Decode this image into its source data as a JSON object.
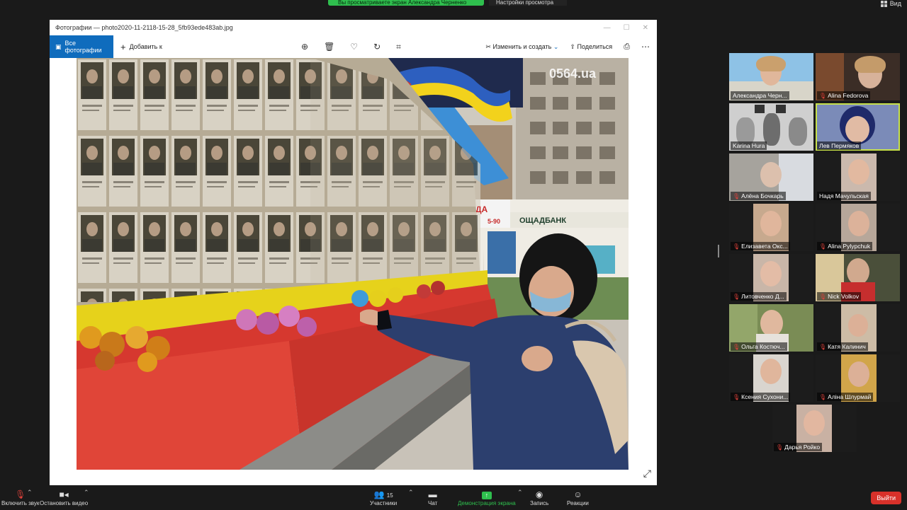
{
  "top": {
    "share_banner": "Вы просматриваете экран Александра Черненко",
    "view_settings": "Настройки просмотра",
    "view_label": "Вид"
  },
  "photo_window": {
    "title": "Фотографии — photo2020-11-2118-15-28_5fb93ede483ab.jpg",
    "all_photos": "Все фотографии",
    "add": "Добавить к",
    "edit_create": "Изменить и создать",
    "share": "Поделиться",
    "watermark": "0564.ua",
    "shop_sign": "ОЩАДБАНК",
    "sign_partial": "ДА",
    "sign_partial2": "5-90"
  },
  "participants": [
    {
      "name": "Александра Черн...",
      "muted": false
    },
    {
      "name": "Alina Fedorova",
      "muted": true
    },
    {
      "name": "Karina Hura",
      "muted": false
    },
    {
      "name": "Лев Пермяков",
      "muted": false,
      "active": true
    },
    {
      "name": "Алёна Бочкарь",
      "muted": true
    },
    {
      "name": "Надя Мачульская",
      "muted": false
    },
    {
      "name": "Елизавета Окс...",
      "muted": true
    },
    {
      "name": "Alina Pylypchuk",
      "muted": true
    },
    {
      "name": "Литовченко Д...",
      "muted": true
    },
    {
      "name": "Nick Volkov",
      "muted": true
    },
    {
      "name": "Ольга Костюч...",
      "muted": true
    },
    {
      "name": "Катя Калинич",
      "muted": true
    },
    {
      "name": "Ксения Сухони...",
      "muted": true
    },
    {
      "name": "Аліна Шлурмай",
      "muted": true
    },
    {
      "name": "Дарья Ройко",
      "muted": true
    }
  ],
  "bottombar": {
    "unmute": "Включить звук",
    "stop_video": "Остановить видео",
    "participants": "Участники",
    "participants_count": "15",
    "chat": "Чат",
    "share_screen": "Демонстрация экрана",
    "record": "Запись",
    "reactions": "Реакции",
    "leave": "Выйти"
  },
  "colors": {
    "accent_blue": "#0f6cbd",
    "share_green": "#2fbf4e",
    "leave_red": "#d8312a",
    "active_border": "#c7e04a"
  }
}
